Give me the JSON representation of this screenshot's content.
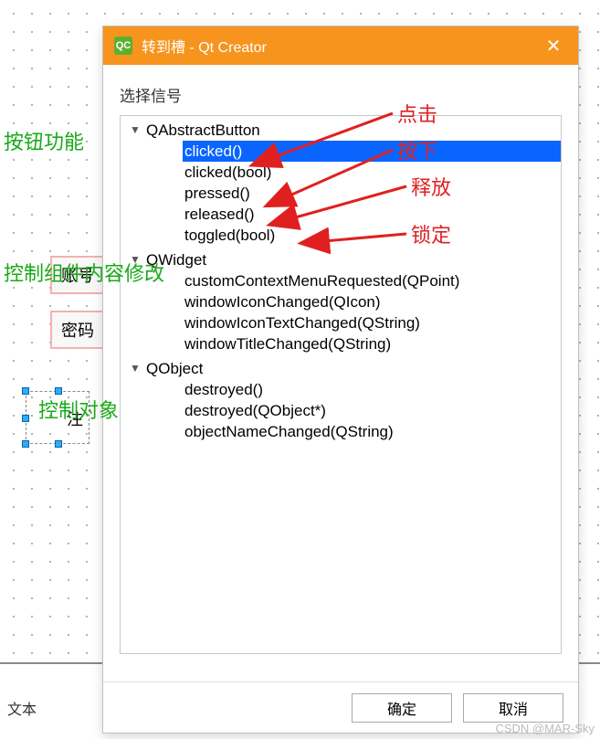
{
  "titlebar": {
    "icon_text": "QC",
    "title": "转到槽 - Qt Creator",
    "close_glyph": "✕"
  },
  "dialog": {
    "section_label": "选择信号"
  },
  "tree": {
    "groups": [
      {
        "name": "qabstractbutton",
        "expand_glyph": "▼",
        "label": "QAbstractButton",
        "items": [
          {
            "label": "clicked()",
            "selected": true
          },
          {
            "label": "clicked(bool)",
            "selected": false
          },
          {
            "label": "pressed()",
            "selected": false
          },
          {
            "label": "released()",
            "selected": false
          },
          {
            "label": "toggled(bool)",
            "selected": false
          }
        ]
      },
      {
        "name": "qwidget",
        "expand_glyph": "▼",
        "label": "QWidget",
        "items": [
          {
            "label": "customContextMenuRequested(QPoint)",
            "selected": false
          },
          {
            "label": "windowIconChanged(QIcon)",
            "selected": false
          },
          {
            "label": "windowIconTextChanged(QString)",
            "selected": false
          },
          {
            "label": "windowTitleChanged(QString)",
            "selected": false
          }
        ]
      },
      {
        "name": "qobject",
        "expand_glyph": "▼",
        "label": "QObject",
        "items": [
          {
            "label": "destroyed()",
            "selected": false
          },
          {
            "label": "destroyed(QObject*)",
            "selected": false
          },
          {
            "label": "objectNameChanged(QString)",
            "selected": false
          }
        ]
      }
    ]
  },
  "footer": {
    "ok_label": "确定",
    "cancel_label": "取消"
  },
  "background": {
    "label1": "账号",
    "label2": "密码",
    "sel_text": "注",
    "bottom_text": "文本"
  },
  "annotations": {
    "btn_func": "按钮功能",
    "widget_modify": "控制组件内容修改",
    "ctrl_obj": "控制对象",
    "click": "点击",
    "press": "按下",
    "release": "释放",
    "lock": "锁定"
  },
  "watermark": "CSDN @MAR-Sky",
  "colors": {
    "title_bg": "#f7941d",
    "selection": "#0a65ff",
    "green": "#1aaa1a",
    "red": "#e02020"
  }
}
